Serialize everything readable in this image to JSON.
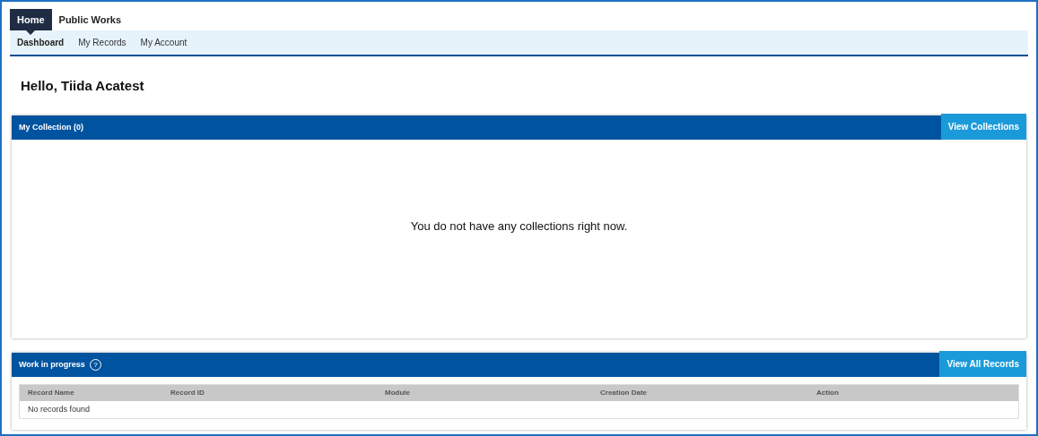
{
  "tabs": [
    {
      "label": "Home",
      "selected": true
    },
    {
      "label": "Public Works",
      "selected": false
    }
  ],
  "subnav": [
    {
      "label": "Dashboard",
      "selected": true
    },
    {
      "label": "My Records",
      "selected": false
    },
    {
      "label": "My Account",
      "selected": false
    }
  ],
  "greeting": "Hello, Tiida Acatest",
  "collection_panel": {
    "title": "My Collection (0)",
    "button": "View Collections",
    "message": "You do not have any collections right now."
  },
  "work_panel": {
    "title": "Work in progress",
    "help_icon": "?",
    "button": "View All Records",
    "columns": [
      "Record Name",
      "Record ID",
      "Module",
      "Creation Date",
      "Action"
    ],
    "empty_message": "No records found"
  }
}
